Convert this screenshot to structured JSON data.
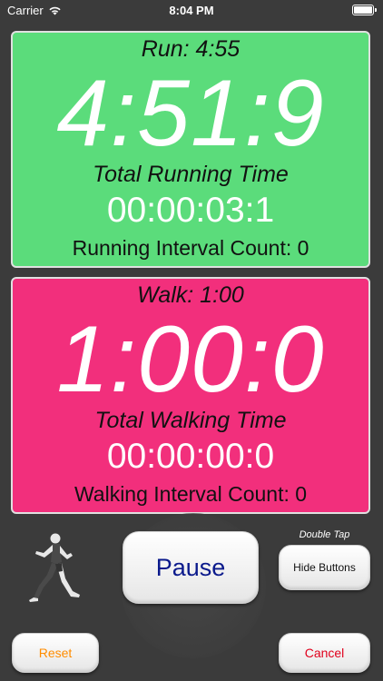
{
  "status": {
    "carrier": "Carrier",
    "time": "8:04 PM"
  },
  "run": {
    "label": "Run:  4:55",
    "countdown": "4:51:9",
    "total_label": "Total Running Time",
    "total_time": "00:00:03:1",
    "count_text": "Running Interval Count: 0"
  },
  "walk": {
    "label": "Walk:  1:00",
    "countdown": "1:00:0",
    "total_label": "Total Walking Time",
    "total_time": "00:00:00:0",
    "count_text": "Walking Interval Count: 0"
  },
  "controls": {
    "pause": "Pause",
    "double_tap": "Double Tap",
    "hide_buttons": "Hide Buttons",
    "reset": "Reset",
    "cancel": "Cancel"
  },
  "colors": {
    "run_panel": "#5bdc7b",
    "walk_panel": "#f22f7c",
    "background": "#3b3b3b",
    "pause_text": "#0b1a8c",
    "reset_text": "#ff8c00",
    "cancel_text": "#e0001c"
  },
  "icons": [
    "wifi-icon",
    "battery-icon",
    "runner-icon",
    "stopwatch-icon"
  ]
}
